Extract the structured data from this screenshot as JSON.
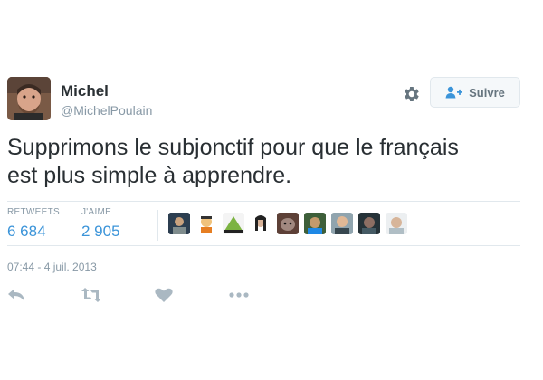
{
  "user": {
    "name": "Michel",
    "handle": "@MichelPoulain"
  },
  "follow_button": {
    "label": "Suivre",
    "icon": "follow-person-plus-icon"
  },
  "settings_icon": "gear-icon",
  "tweet": {
    "text_line1": "Supprimons le subjonctif pour que le français",
    "text_line2": "est plus simple à apprendre.",
    "timestamp": "07:44 - 4 juil. 2013"
  },
  "stats": {
    "retweets_label": "RETWEETS",
    "retweets_value": "6 684",
    "likes_label": "J'AIME",
    "likes_value": "2 905"
  },
  "likers": [
    "liker-avatar-1",
    "liker-avatar-2",
    "liker-avatar-3",
    "liker-avatar-4",
    "liker-avatar-5",
    "liker-avatar-6",
    "liker-avatar-7",
    "liker-avatar-8",
    "liker-avatar-9"
  ],
  "actions": [
    "reply-icon",
    "retweet-icon",
    "like-heart-icon",
    "more-dots-icon"
  ],
  "colors": {
    "link_blue": "#3b94d9",
    "text": "#292f33",
    "muted": "#8899a6",
    "border": "#e1e8ed"
  }
}
